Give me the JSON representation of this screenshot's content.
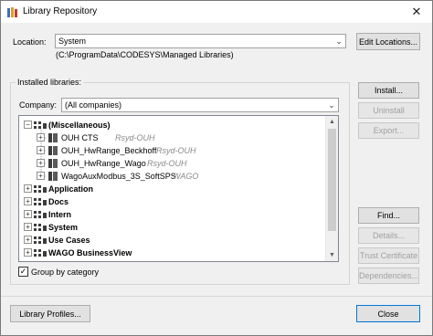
{
  "window": {
    "title": "Library Repository"
  },
  "location": {
    "label": "Location:",
    "value": "System",
    "path": "(C:\\ProgramData\\CODESYS\\Managed Libraries)",
    "edit_button": "Edit Locations..."
  },
  "installed": {
    "group_label": "Installed libraries:",
    "company_label": "Company:",
    "company_value": "(All companies)",
    "tree": [
      {
        "label": "(Miscellaneous)",
        "expanded": true,
        "children": [
          {
            "label": "OUH CTS",
            "vendor": "Rsyd-OUH"
          },
          {
            "label": "OUH_HwRange_Beckhoff",
            "vendor": "Rsyd-OUH"
          },
          {
            "label": "OUH_HwRange_Wago",
            "vendor": "Rsyd-OUH"
          },
          {
            "label": "WagoAuxModbus_3S_SoftSPS",
            "vendor": "WAGO"
          }
        ]
      },
      {
        "label": "Application"
      },
      {
        "label": "Docs"
      },
      {
        "label": "Intern"
      },
      {
        "label": "System"
      },
      {
        "label": "Use Cases"
      },
      {
        "label": "WAGO BusinessView"
      }
    ],
    "group_by_category": {
      "label": "Group by category",
      "checked": true
    }
  },
  "buttons": {
    "install": "Install...",
    "uninstall": "Uninstall",
    "export": "Export...",
    "find": "Find...",
    "details": "Details...",
    "trust_certificate": "Trust Certificate",
    "dependencies": "Dependencies...",
    "library_profiles": "Library Profiles...",
    "close": "Close"
  },
  "colors": {
    "folder_yellow": "#e8b84a",
    "book_dark": "#3c3c3c",
    "tree_line": "#a0a0a0"
  }
}
